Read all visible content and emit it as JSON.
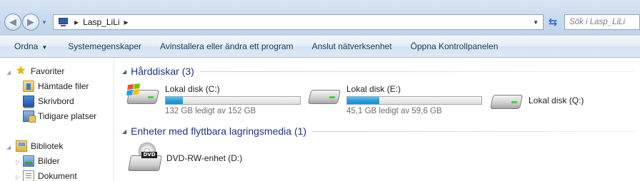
{
  "address_bar": {
    "crumbs": [
      "Lasp_LiLi"
    ],
    "search_placeholder": "Sök i Lasp_LiLi"
  },
  "toolbar": {
    "organize": "Ordna",
    "system_properties": "Systemegenskaper",
    "uninstall": "Avinstallera eller ändra ett program",
    "map_network": "Anslut nätverksenhet",
    "control_panel": "Öppna Kontrollpanelen"
  },
  "nav": {
    "favorites": "Favoriter",
    "downloads": "Hämtade filer",
    "desktop": "Skrivbord",
    "recent": "Tidigare platser",
    "libraries": "Bibliotek",
    "pictures": "Bilder",
    "documents": "Dokument"
  },
  "groups": {
    "hard_disks": "Hårddiskar (3)",
    "removable": "Enheter med flyttbara lagringsmedia (1)"
  },
  "drives": [
    {
      "name": "Lokal disk (C:)",
      "free": "132 GB ledigt av 152 GB",
      "used_fraction": 0.13
    },
    {
      "name": "Lokal disk (E:)",
      "free": "45,1 GB ledigt av 59,6 GB",
      "used_fraction": 0.24
    },
    {
      "name": "Lokal disk (Q:)"
    }
  ],
  "removable_drives": [
    {
      "name": "DVD-RW-enhet (D:)",
      "label": "DVD"
    }
  ],
  "colors": {
    "accent_title": "#1e3287",
    "bar_fill": "#26a0da"
  }
}
